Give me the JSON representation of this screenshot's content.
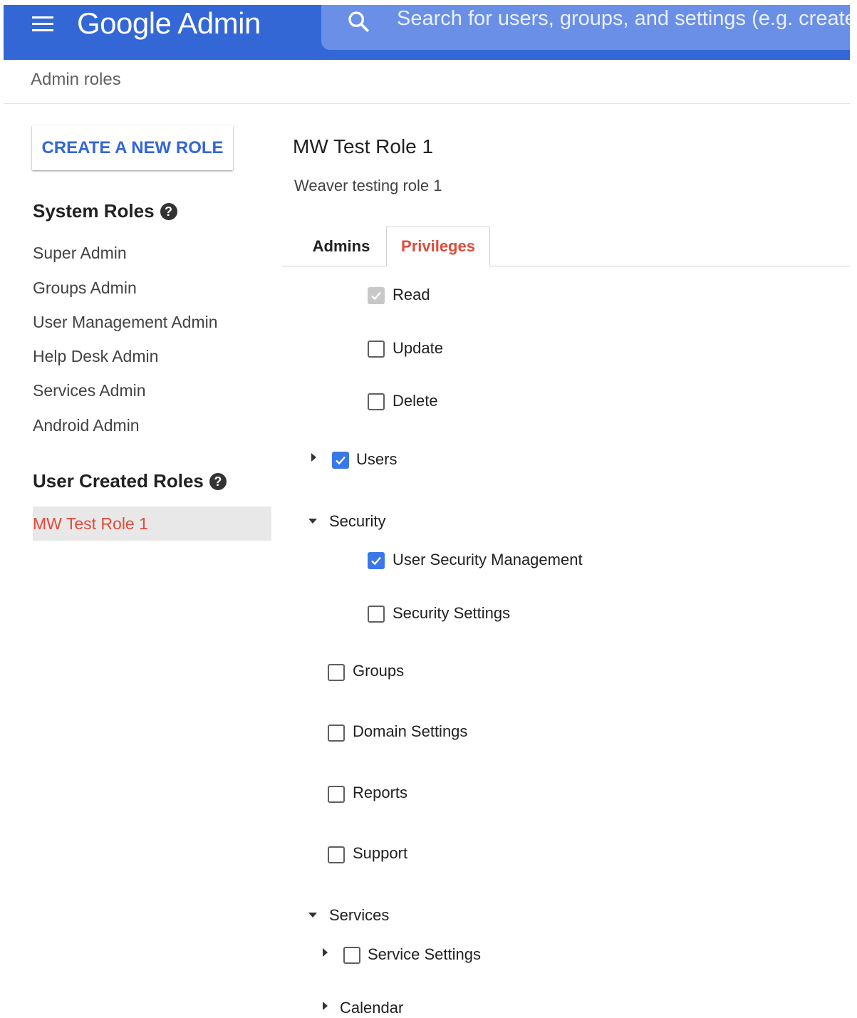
{
  "header": {
    "app_name": "Google Admin",
    "search_placeholder": "Search for users, groups, and settings (e.g. create users)"
  },
  "breadcrumb": "Admin roles",
  "sidebar": {
    "create_button": "CREATE A NEW ROLE",
    "system_roles_heading": "System Roles",
    "system_roles": [
      "Super Admin",
      "Groups Admin",
      "User Management Admin",
      "Help Desk Admin",
      "Services Admin",
      "Android Admin"
    ],
    "user_roles_heading": "User Created Roles",
    "user_roles": [
      "MW Test Role 1"
    ]
  },
  "role": {
    "title": "MW Test Role 1",
    "description": "Weaver testing role 1"
  },
  "tabs": {
    "admins": "Admins",
    "privileges": "Privileges",
    "active": "Privileges"
  },
  "privileges": {
    "read": {
      "label": "Read",
      "checked": true,
      "disabled": true
    },
    "update": {
      "label": "Update",
      "checked": false
    },
    "delete": {
      "label": "Delete",
      "checked": false
    },
    "users": {
      "label": "Users",
      "checked": true,
      "expanded": false
    },
    "security": {
      "label": "Security",
      "expanded": true
    },
    "user_security_management": {
      "label": "User Security Management",
      "checked": true
    },
    "security_settings": {
      "label": "Security Settings",
      "checked": false
    },
    "groups": {
      "label": "Groups",
      "checked": false
    },
    "domain_settings": {
      "label": "Domain Settings",
      "checked": false
    },
    "reports": {
      "label": "Reports",
      "checked": false
    },
    "support": {
      "label": "Support",
      "checked": false
    },
    "services": {
      "label": "Services",
      "expanded": true
    },
    "service_settings": {
      "label": "Service Settings",
      "checked": false,
      "expanded": false
    },
    "calendar": {
      "label": "Calendar",
      "expanded": false
    }
  },
  "colors": {
    "header_bg": "#3367d6",
    "accent_red": "#e04b3a",
    "checkbox_blue": "#3b78e7"
  }
}
